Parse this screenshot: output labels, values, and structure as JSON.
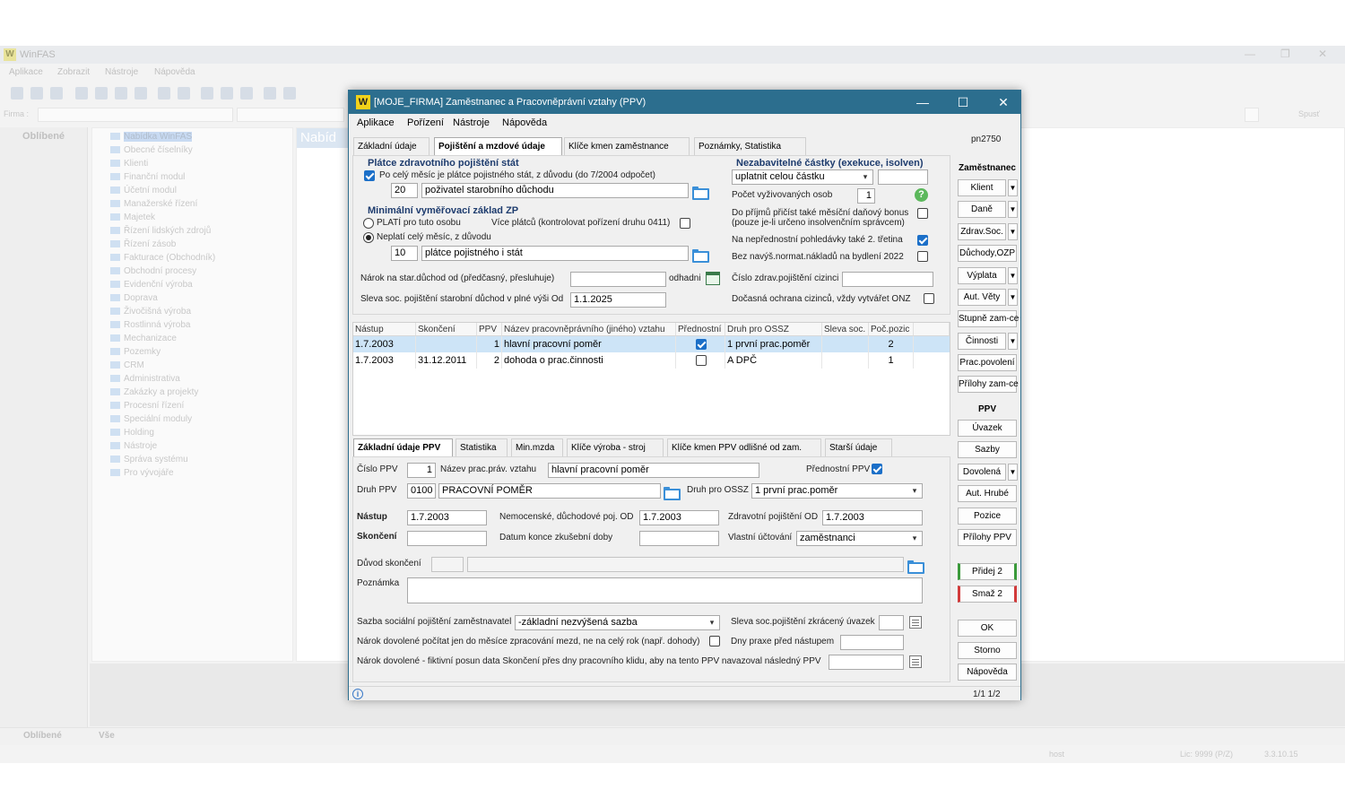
{
  "app": {
    "title": "WinFAS",
    "menu": [
      "Aplikace",
      "Zobrazit",
      "Nástroje",
      "Nápověda"
    ],
    "filter_label": "Firma :",
    "run_label": "Spusť",
    "favorites_header": "Oblíbené",
    "tree": [
      "Nabídka WinFAS",
      "Obecné číselníky",
      "Klienti",
      "Finanční modul",
      "Účetní modul",
      "Manažerské řízení",
      "Majetek",
      "Řízení lidských zdrojů",
      "Řízení zásob",
      "Fakturace (Obchodník)",
      "Obchodní procesy",
      "Evidenční výroba",
      "Doprava",
      "Živočišná výroba",
      "Rostlinná výroba",
      "Mechanizace",
      "Pozemky",
      "CRM",
      "Administrativa",
      "Zakázky a projekty",
      "Procesní řízení",
      "Speciální moduly",
      "Holding",
      "Nástroje",
      "Správa systému",
      "Pro vývojáře"
    ],
    "right_header": "Nabíd",
    "bottom_tabs": [
      "Oblíbené",
      "Vše"
    ],
    "status": {
      "user": "host",
      "lic": "Lic: 9999 (P/Z)",
      "version": "3.3.10.15"
    }
  },
  "dialog": {
    "title": "[MOJE_FIRMA] Zaměstnanec a Pracovněprávní vztahy (PPV)",
    "menu": [
      "Aplikace",
      "Pořízení",
      "Nástroje",
      "Nápověda"
    ],
    "code": "pn2750",
    "top_tabs": [
      "Základní údaje",
      "Pojištění a mzdové údaje",
      "Klíče kmen zaměstnance",
      "Poznámky, Statistika"
    ],
    "platce": {
      "header": "Plátce zdravotního pojištění stát",
      "check_label": "Po celý měsíc je plátce pojistného stát, z důvodu (do 7/2004 odpočet)",
      "code": "20",
      "reason": "poživatel starobního důchodu"
    },
    "minimalni": {
      "header": "Minimální vyměřovací základ ZP",
      "radio1": "PLATÍ pro tuto osobu",
      "multi_label": "Více plátců (kontrolovat pořízení druhu 0411)",
      "radio2": "Neplatí celý měsíc, z důvodu",
      "code": "10",
      "reason": "plátce pojistného i stát"
    },
    "narok_label": "Nárok na star.důchod od (předčasný, přesluhuje)",
    "narok_value": "",
    "odhadni_label": "odhadni",
    "sleva_label": "Sleva soc. pojištění starobní důchod v plné výši Od",
    "sleva_value": "1.1.2025",
    "nezab": {
      "header": "Nezabavitelné částky (exekuce, isolven)",
      "select": "uplatnit celou částku",
      "extra": "",
      "pocet_label": "Počet vyživovaných osob",
      "pocet_value": "1",
      "bonus_label1": "Do příjmů přičíst také měsíční daňový bonus",
      "bonus_label2": "(pouze je-li určeno insolvenčním správcem)",
      "nepred_label": "Na nepřednostní pohledávky také 2. třetina",
      "bez_label": "Bez navýš.normat.nákladů na bydlení 2022",
      "cislo_label": "Číslo zdrav.pojištění cizinci",
      "cislo_value": "",
      "docas_label": "Dočasná ochrana cizinců, vždy vytvářet ONZ"
    },
    "grid": {
      "columns": [
        "Nástup",
        "Skončení",
        "PPV",
        "Název pracovněprávního (jiného) vztahu",
        "Přednostní",
        "Druh pro OSSZ",
        "Sleva soc.",
        "Poč.pozic"
      ],
      "rows": [
        {
          "nastup": "1.7.2003",
          "skonceni": "",
          "ppv": "1",
          "nazev": "hlavní pracovní poměr",
          "prednostni": true,
          "druh": "1 první prac.poměr",
          "sleva": "",
          "pozic": "2"
        },
        {
          "nastup": "1.7.2003",
          "skonceni": "31.12.2011",
          "ppv": "2",
          "nazev": "dohoda o prac.činnosti",
          "prednostni": false,
          "druh": "A DPČ",
          "sleva": "",
          "pozic": "1"
        }
      ]
    },
    "bottom_tabs": [
      "Základní údaje PPV",
      "Statistika",
      "Min.mzda",
      "Klíče výroba - stroj",
      "Klíče kmen PPV odlišné od zam.",
      "Starší údaje"
    ],
    "ppv": {
      "cislo_label": "Číslo PPV",
      "cislo_value": "1",
      "nazev_label": "Název prac.práv. vztahu",
      "nazev_value": "hlavní pracovní poměr",
      "prednostni_label": "Přednostní PPV",
      "druh_label": "Druh PPV",
      "druh_code": "0100",
      "druh_value": "PRACOVNÍ POMĚR",
      "ossz_label": "Druh pro OSSZ",
      "ossz_value": "1 první prac.poměr",
      "nastup_label": "Nástup",
      "nastup_value": "1.7.2003",
      "nemoc_label": "Nemocenské, důchodové poj. OD",
      "nemoc_value": "1.7.2003",
      "zdrav_label": "Zdravotní pojištění OD",
      "zdrav_value": "1.7.2003",
      "skonceni_label": "Skončení",
      "skonceni_value": "",
      "datum_label": "Datum konce zkušební doby",
      "datum_value": "",
      "vlastni_label": "Vlastní účtování",
      "vlastni_value": "zaměstnanci",
      "duvod_label": "Důvod skončení",
      "poznamka_label": "Poznámka",
      "sazba_label": "Sazba sociální pojištění zaměstnavatel",
      "sazba_value": "-základní nezvýšená sazba",
      "sleva_zkr_label": "Sleva soc.pojištění zkrácený úvazek",
      "narok_dov_label": "Nárok dovolené počítat jen do měsíce zpracování mezd, ne na celý rok (např. dohody)",
      "dny_praxe_label": "Dny praxe před nástupem",
      "fikt_label": "Nárok dovolené - fiktivní posun data Skončení přes dny pracovního klidu, aby na tento PPV navazoval následný PPV"
    },
    "side": {
      "emp_header": "Zaměstnanec",
      "emp_buttons": [
        "Klient",
        "Daně",
        "Zdrav.Soc.",
        "Důchody,OZP",
        "Výplata",
        "Aut. Věty",
        "Stupně zam-ce",
        "Činnosti",
        "Prac.povolení",
        "Přílohy zam-ce"
      ],
      "ppv_header": "PPV",
      "ppv_buttons": [
        "Úvazek",
        "Sazby",
        "Dovolená",
        "Aut. Hrubé",
        "Pozice",
        "Přílohy PPV"
      ],
      "add": "Přidej 2",
      "del": "Smaž 2",
      "ok": "OK",
      "cancel": "Storno",
      "help": "Nápověda"
    },
    "pager": "1/1  1/2"
  }
}
